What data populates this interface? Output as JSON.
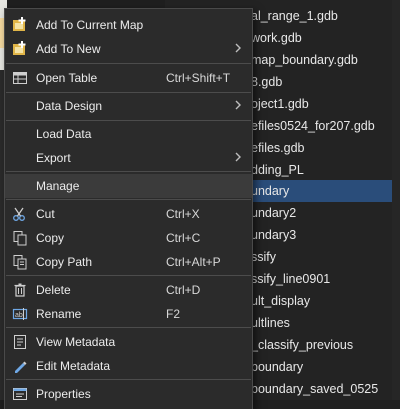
{
  "catalog": {
    "items": [
      {
        "label": "al_range_1.gdb",
        "selected": false,
        "partial": true
      },
      {
        "label": "work.gdb",
        "selected": false
      },
      {
        "label": "map_boundary.gdb",
        "selected": false
      },
      {
        "label": "8.gdb",
        "selected": false
      },
      {
        "label": "oject1.gdb",
        "selected": false
      },
      {
        "label": "efiles0524_for207.gdb",
        "selected": false
      },
      {
        "label": "efiles.gdb",
        "selected": false
      },
      {
        "label": "dding_PL",
        "selected": false
      },
      {
        "label": "undary",
        "selected": true
      },
      {
        "label": "undary2",
        "selected": false
      },
      {
        "label": "undary3",
        "selected": false
      },
      {
        "label": "ssify",
        "selected": false
      },
      {
        "label": "ssify_line0901",
        "selected": false
      },
      {
        "label": "ult_display",
        "selected": false
      },
      {
        "label": "ultlines",
        "selected": false
      },
      {
        "label": "_classify_previous",
        "selected": false
      },
      {
        "label": "boundary",
        "selected": false
      },
      {
        "label": "boundary_saved_0525",
        "selected": false
      }
    ]
  },
  "menu": {
    "items": [
      {
        "label": "Add To Current Map",
        "shortcut": "",
        "icon": "add-to-map-icon",
        "submenu": false
      },
      {
        "label": "Add To New",
        "shortcut": "",
        "icon": "add-to-new-icon",
        "submenu": true
      },
      {
        "label": "Open Table",
        "shortcut": "Ctrl+Shift+T",
        "icon": "table-icon",
        "submenu": false
      },
      {
        "label": "Data Design",
        "shortcut": "",
        "icon": "",
        "submenu": true
      },
      {
        "label": "Load Data",
        "shortcut": "",
        "icon": "",
        "submenu": false
      },
      {
        "label": "Export",
        "shortcut": "",
        "icon": "",
        "submenu": true
      },
      {
        "label": "Manage",
        "shortcut": "",
        "icon": "",
        "submenu": false,
        "highlighted": true
      },
      {
        "label": "Cut",
        "shortcut": "Ctrl+X",
        "icon": "scissors-icon",
        "submenu": false
      },
      {
        "label": "Copy",
        "shortcut": "Ctrl+C",
        "icon": "copy-icon",
        "submenu": false
      },
      {
        "label": "Copy Path",
        "shortcut": "Ctrl+Alt+P",
        "icon": "copy-path-icon",
        "submenu": false
      },
      {
        "label": "Delete",
        "shortcut": "Ctrl+D",
        "icon": "trash-icon",
        "submenu": false
      },
      {
        "label": "Rename",
        "shortcut": "F2",
        "icon": "rename-icon",
        "submenu": false
      },
      {
        "label": "View Metadata",
        "shortcut": "",
        "icon": "view-metadata-icon",
        "submenu": false
      },
      {
        "label": "Edit Metadata",
        "shortcut": "",
        "icon": "edit-metadata-icon",
        "submenu": false
      },
      {
        "label": "Properties",
        "shortcut": "",
        "icon": "properties-icon",
        "submenu": false
      }
    ]
  },
  "colors": {
    "selection": "#2a4d7a",
    "menu_background": "#2b2b2b",
    "gdb_icon": "#d9b25a"
  }
}
